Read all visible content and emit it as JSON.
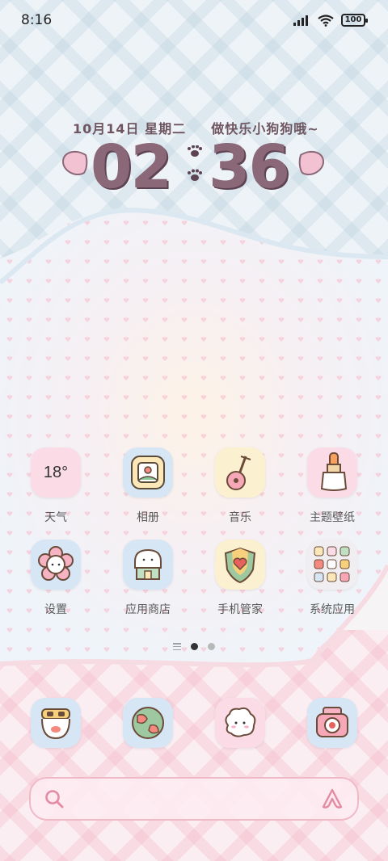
{
  "status_bar": {
    "time": "8:16",
    "battery": "100",
    "icons": [
      "signal-icon",
      "wifi-icon",
      "battery-icon"
    ]
  },
  "clock_widget": {
    "date": "10月14日 星期二",
    "slogan": "做快乐小狗狗哦~",
    "hour": "02",
    "minute": "36"
  },
  "apps": [
    {
      "label": "天气",
      "icon": "weather-icon",
      "temp": "18°",
      "bg": "#fadbe6"
    },
    {
      "label": "相册",
      "icon": "album-icon",
      "bg": "#d6e6f5"
    },
    {
      "label": "音乐",
      "icon": "guitar-icon",
      "bg": "#fbf0cf"
    },
    {
      "label": "主题壁纸",
      "icon": "theme-icon",
      "bg": "#fadbe6"
    },
    {
      "label": "设置",
      "icon": "settings-icon",
      "bg": "#d6e6f5"
    },
    {
      "label": "应用商店",
      "icon": "app-store-icon",
      "bg": "#d6e6f5"
    },
    {
      "label": "手机管家",
      "icon": "phone-manager-icon",
      "bg": "#fbf0cf"
    },
    {
      "label": "系统应用",
      "icon": "system-apps-folder-icon",
      "bg": "#f1eef2"
    }
  ],
  "dock": [
    {
      "icon": "phone-icon",
      "bg": "#d6e6f5"
    },
    {
      "icon": "browser-icon",
      "bg": "#d6e6f5"
    },
    {
      "icon": "messages-icon",
      "bg": "#fadbe6"
    },
    {
      "icon": "camera-icon",
      "bg": "#d6e6f5"
    }
  ],
  "pager": {
    "pages": 2,
    "current": 1
  },
  "search": {
    "icon": "search-icon",
    "assistant_icon": "assistant-icon"
  },
  "colors": {
    "accent_pink": "#f0b9c8",
    "clock_mauve": "#8a6878"
  }
}
